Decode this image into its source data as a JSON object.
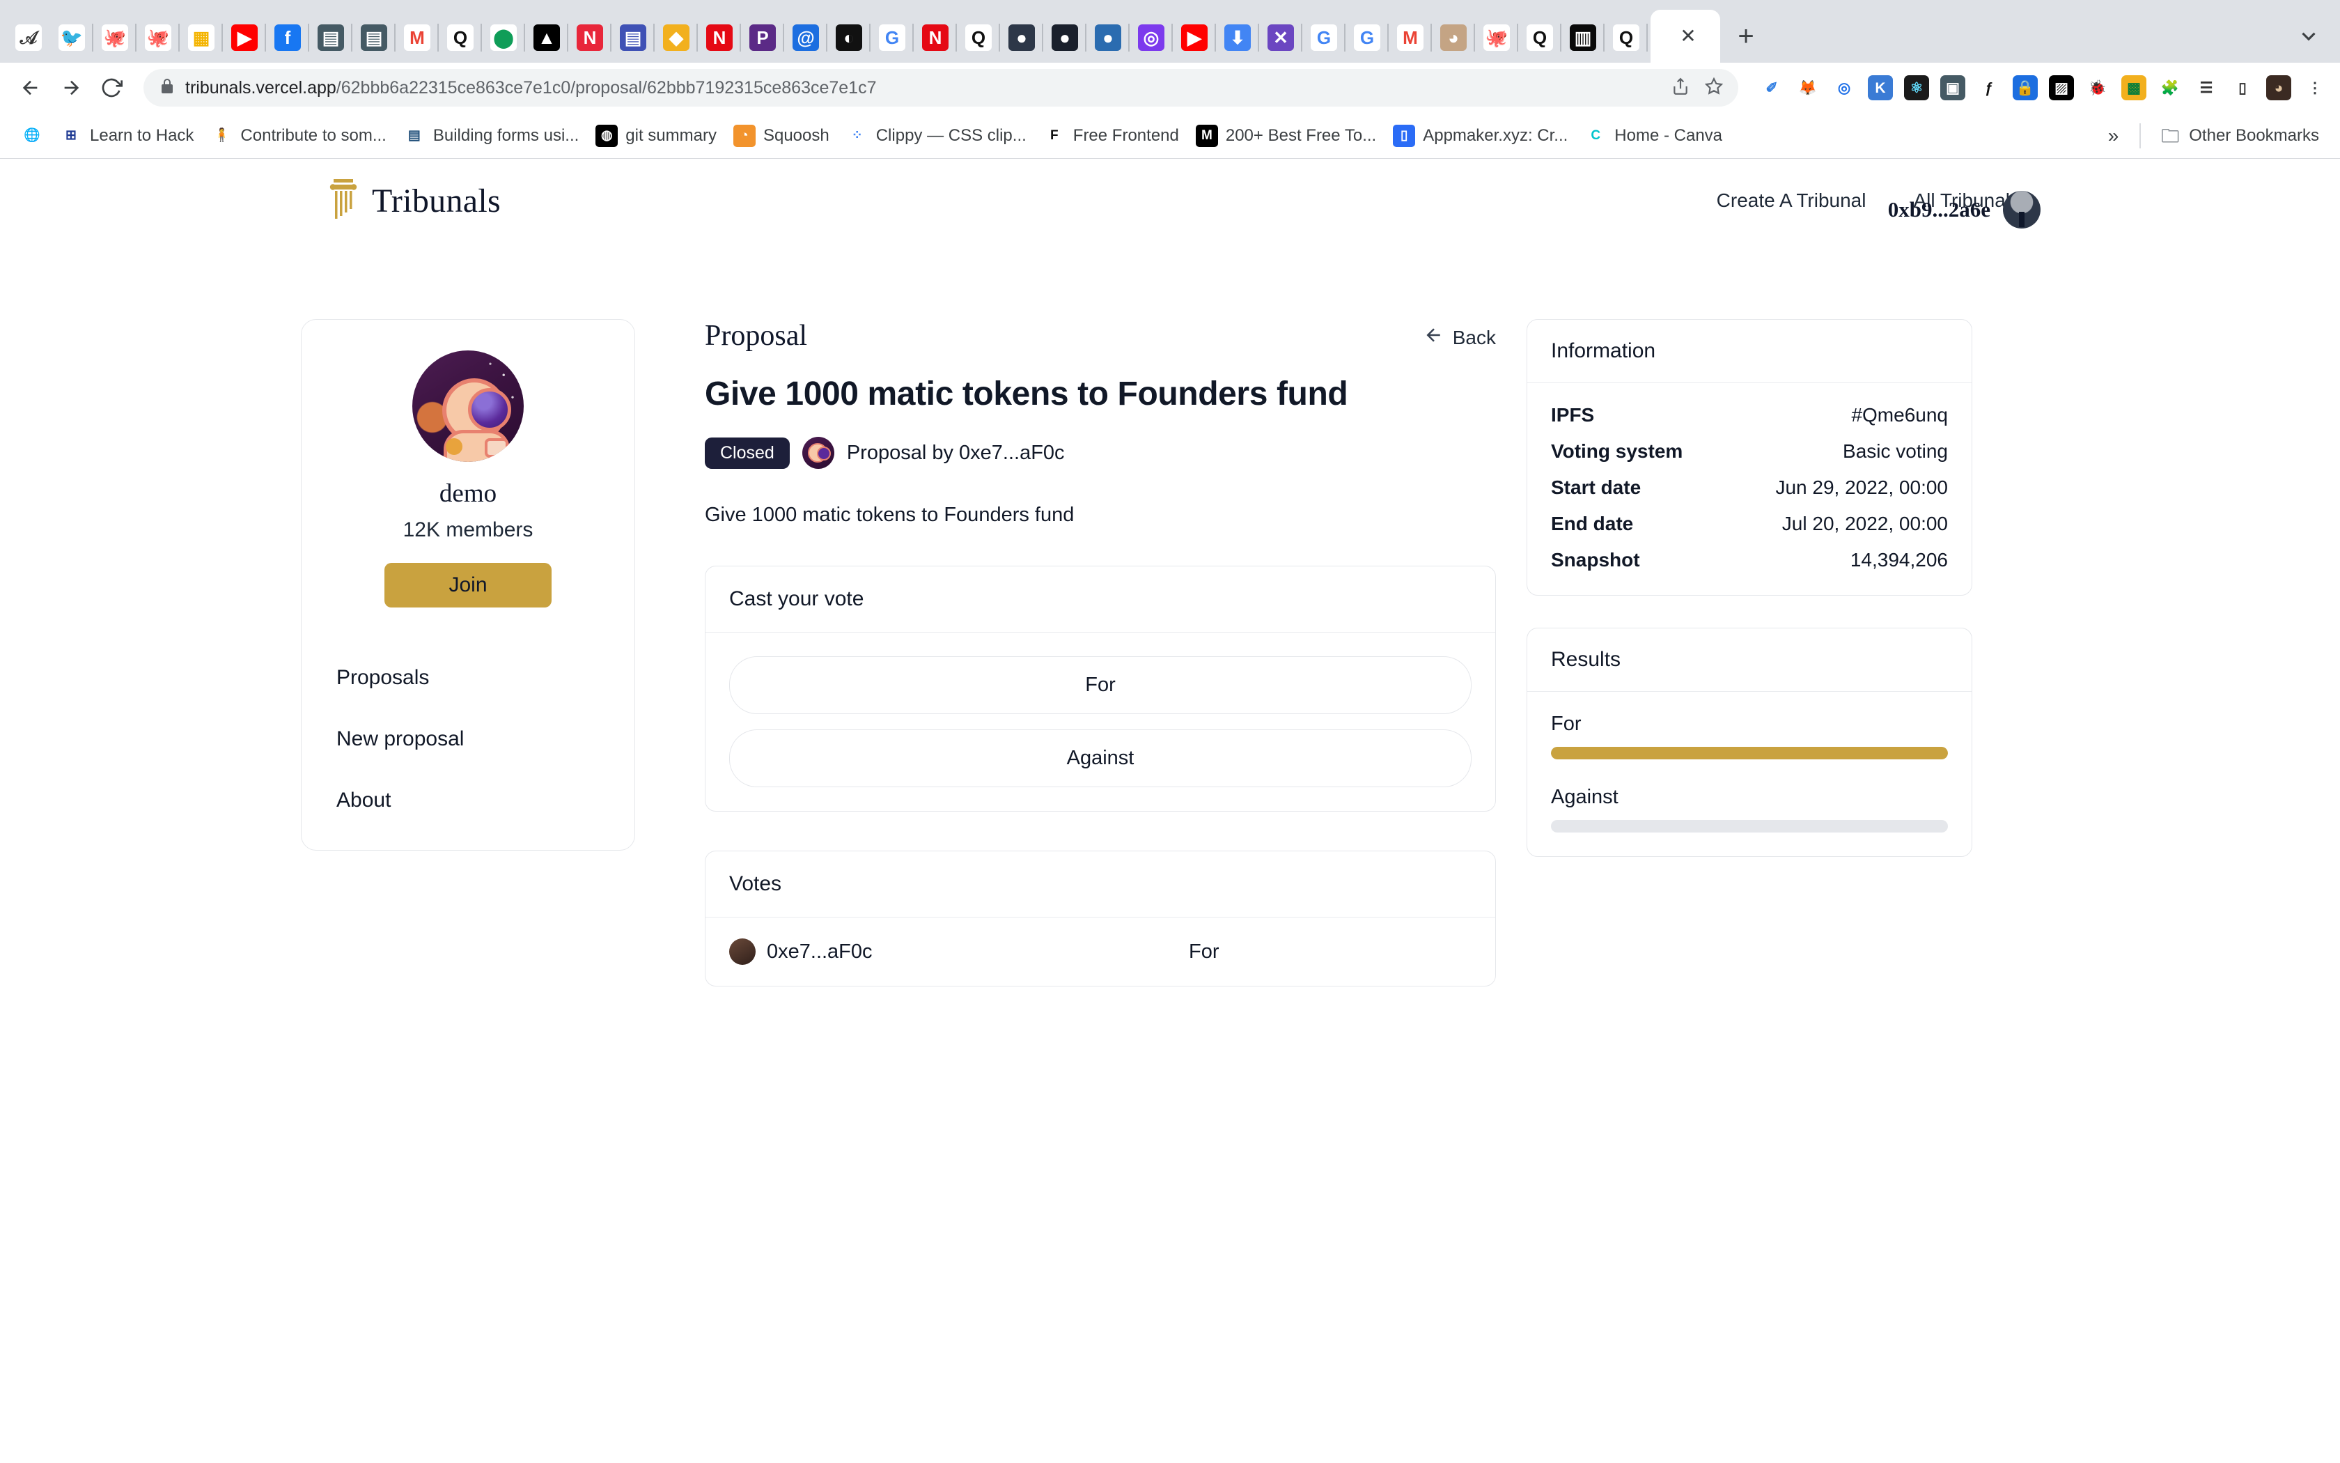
{
  "browser": {
    "tabs_pinned": [
      {
        "name": "atom-tab",
        "glyph": "𝒜",
        "bg": "#ffffff",
        "fg": "#333333"
      },
      {
        "name": "twitter-tab",
        "glyph": "🐦",
        "bg": "#ffffff",
        "fg": "#1da1f2"
      },
      {
        "name": "github-tab",
        "glyph": "🐙",
        "bg": "#ffffff",
        "fg": "#24292e"
      },
      {
        "name": "github-tab-2",
        "glyph": "🐙",
        "bg": "#ffffff",
        "fg": "#24292e"
      },
      {
        "name": "google-slides-tab",
        "glyph": "▦",
        "bg": "#ffffff",
        "fg": "#f4b400"
      },
      {
        "name": "youtube-music-tab",
        "glyph": "▶",
        "bg": "#ff0000",
        "fg": "#ffffff"
      },
      {
        "name": "facebook-tab",
        "glyph": "f",
        "bg": "#1877f2",
        "fg": "#ffffff"
      },
      {
        "name": "doc-tab",
        "glyph": "▤",
        "bg": "#455a64",
        "fg": "#ffffff"
      },
      {
        "name": "doc-tab-2",
        "glyph": "▤",
        "bg": "#455a64",
        "fg": "#ffffff"
      },
      {
        "name": "gmail-tab",
        "glyph": "M",
        "bg": "#ffffff",
        "fg": "#ea4335"
      },
      {
        "name": "quora-tab",
        "glyph": "Q",
        "bg": "#ffffff",
        "fg": "#111111"
      },
      {
        "name": "medium-tab",
        "glyph": "⬤",
        "bg": "#ffffff",
        "fg": "#0f9d58"
      },
      {
        "name": "vercel-tab",
        "glyph": "▲",
        "bg": "#000000",
        "fg": "#ffffff"
      },
      {
        "name": "notion-tab",
        "glyph": "N",
        "bg": "#e8263a",
        "fg": "#ffffff"
      },
      {
        "name": "dev-tab",
        "glyph": "▤",
        "bg": "#3f51b5",
        "fg": "#ffffff"
      },
      {
        "name": "gold-tab",
        "glyph": "◆",
        "bg": "#f2b01e",
        "fg": "#ffffff"
      },
      {
        "name": "netflix-tab",
        "glyph": "N",
        "bg": "#e50914",
        "fg": "#ffffff"
      },
      {
        "name": "purple-tab",
        "glyph": "P",
        "bg": "#5b2a86",
        "fg": "#ffffff"
      },
      {
        "name": "mail-tab",
        "glyph": "@",
        "bg": "#1c6ee0",
        "fg": "#ffffff"
      },
      {
        "name": "dark-tab",
        "glyph": "◐",
        "bg": "#111111",
        "fg": "#ffffff"
      },
      {
        "name": "google-tab",
        "glyph": "G",
        "bg": "#ffffff",
        "fg": "#4285f4"
      },
      {
        "name": "netflix-tab-2",
        "glyph": "N",
        "bg": "#e50914",
        "fg": "#ffffff"
      },
      {
        "name": "quora-tab-2",
        "glyph": "Q",
        "bg": "#ffffff",
        "fg": "#111111"
      },
      {
        "name": "sphere-tab",
        "glyph": "●",
        "bg": "#2d3748",
        "fg": "#ffffff"
      },
      {
        "name": "sphere-tab-2",
        "glyph": "●",
        "bg": "#1a202c",
        "fg": "#ffffff"
      },
      {
        "name": "blue-sphere-tab",
        "glyph": "●",
        "bg": "#2b6cb0",
        "fg": "#ffffff"
      },
      {
        "name": "circle-tab",
        "glyph": "◎",
        "bg": "#7c3aed",
        "fg": "#ffffff"
      },
      {
        "name": "youtube-tab",
        "glyph": "▶",
        "bg": "#ff0000",
        "fg": "#ffffff"
      },
      {
        "name": "download-tab",
        "glyph": "⬇",
        "bg": "#4285f4",
        "fg": "#ffffff"
      },
      {
        "name": "dx-tab",
        "glyph": "✕",
        "bg": "#6b46c1",
        "fg": "#ffffff"
      },
      {
        "name": "google-tab-2",
        "glyph": "G",
        "bg": "#ffffff",
        "fg": "#4285f4"
      },
      {
        "name": "google-tab-3",
        "glyph": "G",
        "bg": "#ffffff",
        "fg": "#4285f4"
      },
      {
        "name": "gmail-tab-2",
        "glyph": "M",
        "bg": "#ffffff",
        "fg": "#ea4335"
      },
      {
        "name": "avatar-tab",
        "glyph": "◕",
        "bg": "#c4a484",
        "fg": "#ffffff"
      },
      {
        "name": "github-tab-3",
        "glyph": "🐙",
        "bg": "#ffffff",
        "fg": "#24292e"
      },
      {
        "name": "quora-tab-3",
        "glyph": "Q",
        "bg": "#ffffff",
        "fg": "#111111"
      },
      {
        "name": "devto-tab",
        "glyph": "▥",
        "bg": "#0a0a0a",
        "fg": "#ffffff"
      },
      {
        "name": "quora-tab-4",
        "glyph": "Q",
        "bg": "#ffffff",
        "fg": "#111111"
      }
    ],
    "active_tab": {
      "title": "",
      "close": "✕"
    },
    "new_tab": "+",
    "tab_list_chevron": "⌄",
    "nav": {
      "back": "←",
      "forward": "→",
      "reload": "⟳"
    },
    "omnibox": {
      "lock": "🔒",
      "url_host": "tribunals.vercel.app",
      "url_path": "/62bbb6a22315ce863ce7e1c0/proposal/62bbb7192315ce863ce7e1c7",
      "share": "⇪",
      "bookmark_star": "☆"
    },
    "extensions": [
      {
        "name": "eyedropper-extension",
        "glyph": "✐",
        "bg": "#ffffff",
        "fg": "#2f7de1"
      },
      {
        "name": "metamask-extension",
        "glyph": "🦊",
        "bg": "#ffffff",
        "fg": "#e2761b"
      },
      {
        "name": "spiral-extension",
        "glyph": "◎",
        "bg": "#ffffff",
        "fg": "#1d6fe8"
      },
      {
        "name": "kami-extension",
        "glyph": "K",
        "bg": "#3a7bd5",
        "fg": "#ffffff"
      },
      {
        "name": "react-devtools-extension",
        "glyph": "⚛",
        "bg": "#1a1a1a",
        "fg": "#61dafb"
      },
      {
        "name": "new-tab-extension",
        "glyph": "▣",
        "bg": "#455a64",
        "fg": "#ffffff"
      },
      {
        "name": "font-finder-extension",
        "glyph": "ƒ",
        "bg": "#ffffff",
        "fg": "#111111"
      },
      {
        "name": "password-lock-extension",
        "glyph": "🔒",
        "bg": "#1c6ee0",
        "fg": "#ffffff"
      },
      {
        "name": "pattern-extension",
        "glyph": "▨",
        "bg": "#000000",
        "fg": "#ffffff"
      },
      {
        "name": "bug-tracker-extension",
        "glyph": "🐞",
        "bg": "#ffffff",
        "fg": "#555555"
      },
      {
        "name": "chip-extension",
        "glyph": "▩",
        "bg": "#f2b01e",
        "fg": "#0a7d3a"
      },
      {
        "name": "puzzle-extensions-menu",
        "glyph": "🧩",
        "bg": "#ffffff",
        "fg": "#5f6368"
      },
      {
        "name": "playlist-extension",
        "glyph": "☰",
        "bg": "#ffffff",
        "fg": "#333333"
      },
      {
        "name": "sidebar-extension",
        "glyph": "▯",
        "bg": "#ffffff",
        "fg": "#333333"
      },
      {
        "name": "profile-avatar",
        "glyph": "◕",
        "bg": "#3b2a22",
        "fg": "#e0c3a0"
      },
      {
        "name": "chrome-menu",
        "glyph": "⋮",
        "bg": "#ffffff",
        "fg": "#3c4043"
      }
    ],
    "bookmarks": [
      {
        "label": "",
        "name": "globe-bookmark",
        "glyph": "🌐",
        "bg": "#ffffff",
        "fg": "#5f6368"
      },
      {
        "label": "Learn to Hack",
        "name": "learn-to-hack-bookmark",
        "glyph": "⊞",
        "bg": "#ffffff",
        "fg": "#1f3a93"
      },
      {
        "label": "Contribute to som...",
        "name": "contribute-bookmark",
        "glyph": "🧍",
        "bg": "#ffffff",
        "fg": "#2b4a6f"
      },
      {
        "label": "Building forms usi...",
        "name": "building-forms-bookmark",
        "glyph": "▤",
        "bg": "#ffffff",
        "fg": "#1f4e79"
      },
      {
        "label": "git summary",
        "name": "git-summary-bookmark",
        "glyph": "◍",
        "bg": "#000000",
        "fg": "#ffffff"
      },
      {
        "label": "Squoosh",
        "name": "squoosh-bookmark",
        "glyph": "◔",
        "bg": "#f2932c",
        "fg": "#ffffff"
      },
      {
        "label": "Clippy — CSS clip...",
        "name": "clippy-bookmark",
        "glyph": "⁘",
        "bg": "#ffffff",
        "fg": "#4285f4"
      },
      {
        "label": "Free Frontend",
        "name": "free-frontend-bookmark",
        "glyph": "F",
        "bg": "#ffffff",
        "fg": "#111111"
      },
      {
        "label": "200+ Best Free To...",
        "name": "medium-200-bookmark",
        "glyph": "M",
        "bg": "#000000",
        "fg": "#ffffff"
      },
      {
        "label": "Appmaker.xyz: Cr...",
        "name": "appmaker-bookmark",
        "glyph": "▯",
        "bg": "#2b6cf6",
        "fg": "#ffffff"
      },
      {
        "label": "Home - Canva",
        "name": "canva-bookmark",
        "glyph": "C",
        "bg": "#ffffff",
        "fg": "#00c4cc"
      }
    ],
    "bookmarks_overflow": "»",
    "other_bookmarks": {
      "label": "Other Bookmarks",
      "glyph": "🗀"
    }
  },
  "site": {
    "brand": {
      "name": "Tribunals",
      "logo": "column-logo"
    },
    "nav": [
      {
        "label": "Create A Tribunal",
        "name": "nav-create-a-tribunal"
      },
      {
        "label": "All Tribunals",
        "name": "nav-all-tribunals"
      }
    ],
    "account": {
      "address": "0xb9...2a6e"
    }
  },
  "sidebar": {
    "tribunal_name": "demo",
    "members": "12K members",
    "join_label": "Join",
    "links": [
      {
        "label": "Proposals",
        "name": "sidebar-link-proposals"
      },
      {
        "label": "New proposal",
        "name": "sidebar-link-new-proposal"
      },
      {
        "label": "About",
        "name": "sidebar-link-about"
      }
    ]
  },
  "proposal": {
    "kicker": "Proposal",
    "back_label": "Back",
    "back_arrow": "←",
    "title": "Give 1000 matic tokens to Founders fund",
    "status_badge": "Closed",
    "author_line": "Proposal by 0xe7...aF0c",
    "body": "Give 1000 matic tokens to Founders fund"
  },
  "vote_card": {
    "heading": "Cast your vote",
    "options": [
      {
        "label": "For",
        "name": "vote-option-for"
      },
      {
        "label": "Against",
        "name": "vote-option-against"
      }
    ]
  },
  "votes_card": {
    "heading": "Votes",
    "rows": [
      {
        "voter": "0xe7...aF0c",
        "choice": "For"
      }
    ]
  },
  "information": {
    "heading": "Information",
    "rows": [
      {
        "key": "IPFS",
        "value": "#Qme6unq"
      },
      {
        "key": "Voting system",
        "value": "Basic voting"
      },
      {
        "key": "Start date",
        "value": "Jun 29, 2022, 00:00"
      },
      {
        "key": "End date",
        "value": "Jul 20, 2022, 00:00"
      },
      {
        "key": "Snapshot",
        "value": "14,394,206"
      }
    ]
  },
  "results": {
    "heading": "Results",
    "items": [
      {
        "label": "For",
        "percent": 100
      },
      {
        "label": "Against",
        "percent": 0
      }
    ]
  },
  "theme": {
    "gold": "#c9a23f",
    "navy": "#1d1f3a",
    "border": "#e5e7eb",
    "text": "#111827"
  }
}
